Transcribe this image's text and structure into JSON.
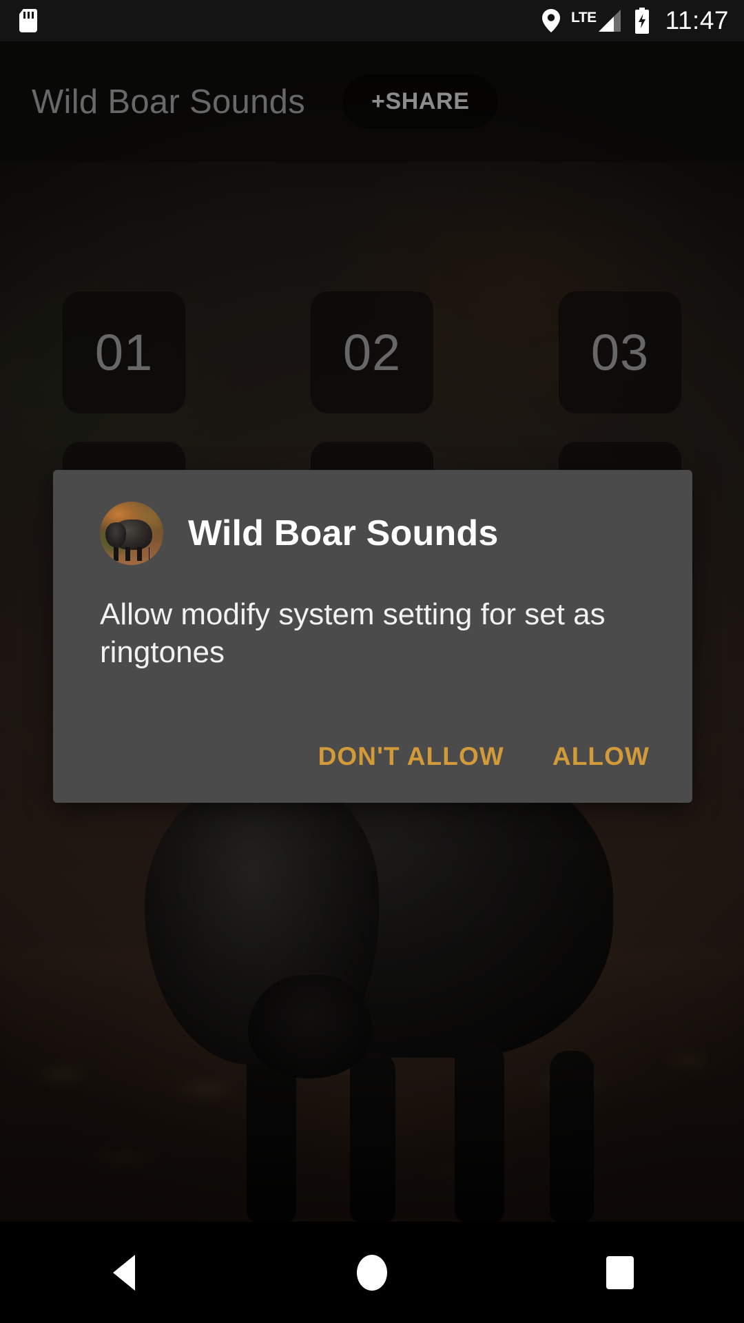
{
  "status_bar": {
    "sd_card_icon": "sd-card-icon",
    "location_icon": "location-pin-icon",
    "network_type": "LTE",
    "signal_icon": "signal-bars-icon",
    "battery_icon": "battery-charging-icon",
    "clock": "11:47"
  },
  "app_bar": {
    "title": "Wild Boar Sounds",
    "share_label": "+SHARE"
  },
  "grid": {
    "tiles": [
      {
        "label": "01"
      },
      {
        "label": "02"
      },
      {
        "label": "03"
      },
      {
        "label": ""
      },
      {
        "label": ""
      },
      {
        "label": ""
      }
    ]
  },
  "dialog": {
    "avatar_icon": "app-avatar-wild-boar",
    "title": "Wild Boar Sounds",
    "message": "Allow modify system setting for set as ringtones",
    "deny_label": "DON'T ALLOW",
    "allow_label": "ALLOW",
    "accent_color": "#d39a3a",
    "background_color": "#4b4b4b"
  },
  "nav_bar": {
    "back_icon": "back-triangle-icon",
    "home_icon": "home-circle-icon",
    "recents_icon": "recents-square-icon"
  }
}
